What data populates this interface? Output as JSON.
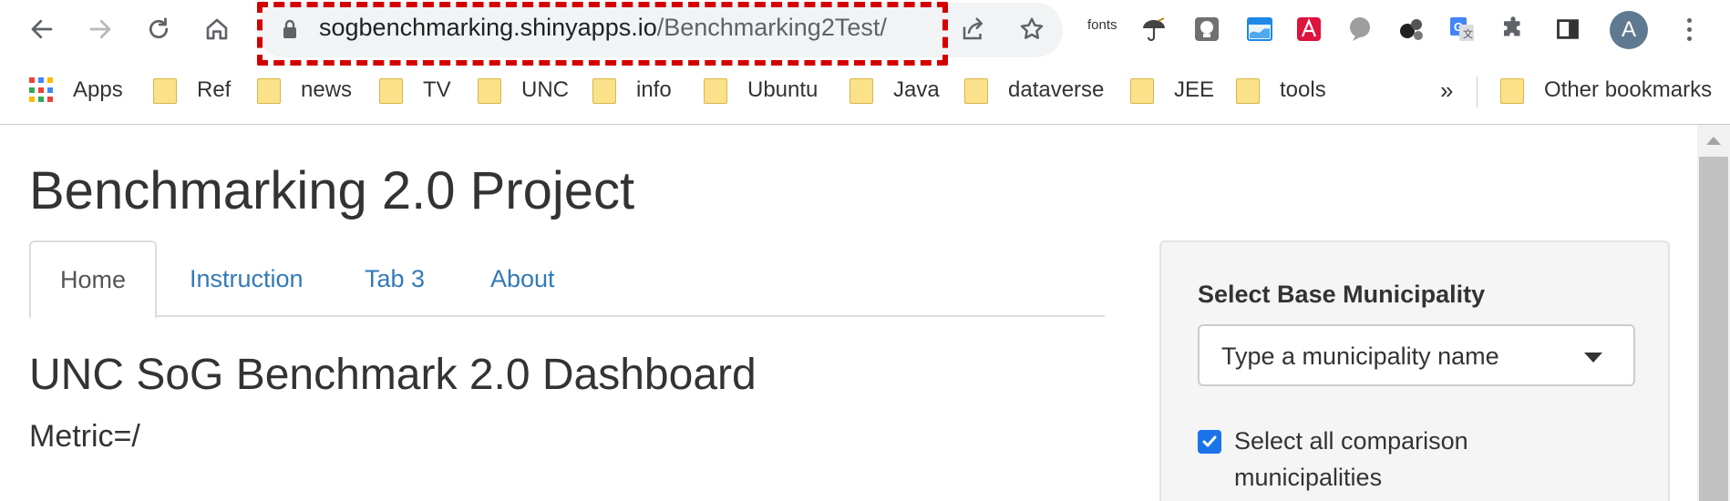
{
  "browser": {
    "url_host": "sogbenchmarking.shinyapps.io",
    "url_path": "/Benchmarking2Test/",
    "nav_icons": [
      "back-arrow-icon",
      "forward-arrow-icon",
      "reload-icon",
      "home-icon"
    ],
    "omnibox_icons": [
      "share-icon",
      "bookmark-star-icon"
    ],
    "extensions_label": "fonts",
    "profile_initial": "A",
    "highlight_color": "#d40000"
  },
  "bookmarks": {
    "apps_label": "Apps",
    "items": [
      "Ref",
      "news",
      "TV",
      "UNC",
      "info",
      "Ubuntu",
      "Java",
      "dataverse",
      "JEE",
      "tools"
    ],
    "more_label": "»",
    "other_label": "Other bookmarks"
  },
  "page": {
    "title": "Benchmarking 2.0 Project",
    "tabs": [
      "Home",
      "Instruction",
      "Tab 3",
      "About"
    ],
    "active_tab": "Home",
    "dashboard_title": "UNC SoG Benchmark 2.0 Dashboard",
    "metric_text": "Metric=/"
  },
  "sidebar": {
    "base_label": "Select Base Municipality",
    "select_placeholder": "Type a municipality name",
    "checkbox_checked": true,
    "checkbox_label": "Select all comparison municipalities"
  },
  "colors": {
    "link": "#337ab7",
    "checkbox": "#1a73e8",
    "panel_bg": "#f5f5f5"
  }
}
